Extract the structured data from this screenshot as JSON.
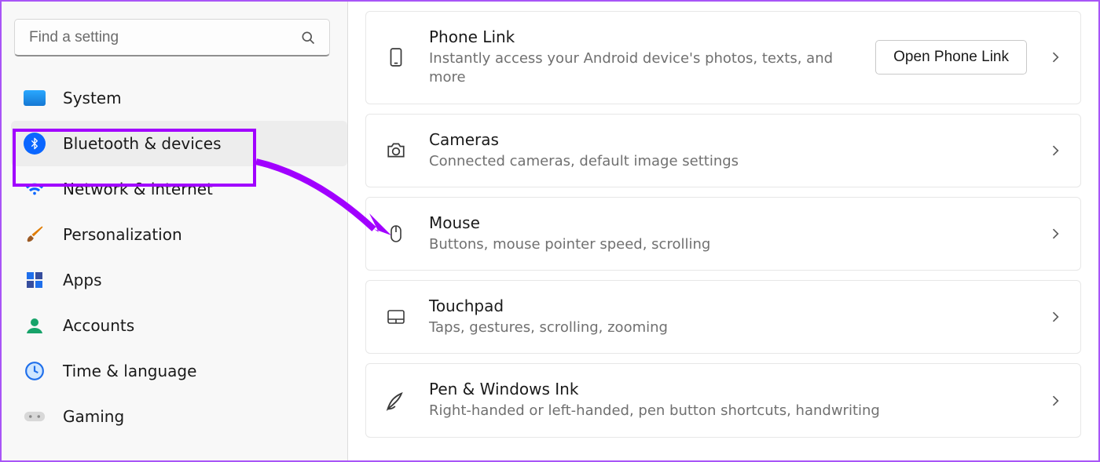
{
  "search": {
    "placeholder": "Find a setting"
  },
  "sidebar": {
    "items": [
      {
        "label": "System"
      },
      {
        "label": "Bluetooth & devices"
      },
      {
        "label": "Network & internet"
      },
      {
        "label": "Personalization"
      },
      {
        "label": "Apps"
      },
      {
        "label": "Accounts"
      },
      {
        "label": "Time & language"
      },
      {
        "label": "Gaming"
      }
    ],
    "active_index": 1
  },
  "main": {
    "cards": [
      {
        "title": "Phone Link",
        "sub": "Instantly access your Android device's photos, texts, and more",
        "button": "Open Phone Link"
      },
      {
        "title": "Cameras",
        "sub": "Connected cameras, default image settings"
      },
      {
        "title": "Mouse",
        "sub": "Buttons, mouse pointer speed, scrolling"
      },
      {
        "title": "Touchpad",
        "sub": "Taps, gestures, scrolling, zooming"
      },
      {
        "title": "Pen & Windows Ink",
        "sub": "Right-handed or left-handed, pen button shortcuts, handwriting"
      }
    ]
  }
}
